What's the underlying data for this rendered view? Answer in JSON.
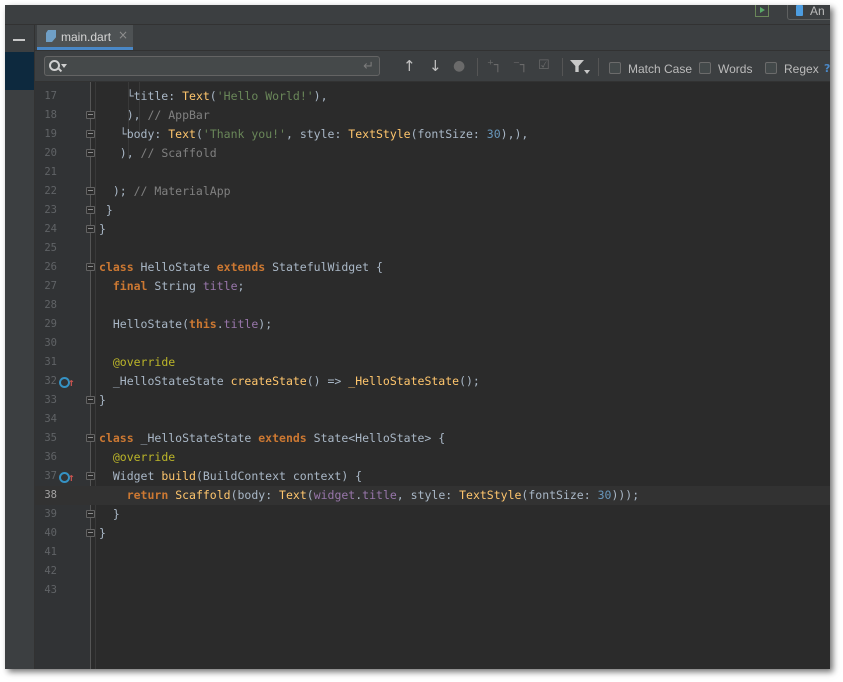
{
  "colors": {
    "background": "#2b2b2b",
    "keyword": "#cc7832",
    "function": "#ffc66d",
    "string": "#6a8759",
    "number": "#6897bb",
    "comment": "#808080",
    "field": "#9876aa",
    "annotation": "#bbb529",
    "accent": "#4a88c7"
  },
  "toolbar": {
    "device_label": "An"
  },
  "tabs": [
    {
      "label": "main.dart",
      "close": "×",
      "icon": "dart-file-icon"
    }
  ],
  "search": {
    "value": "",
    "placeholder": "",
    "options": {
      "match_case": "Match Case",
      "words": "Words",
      "regex": "Regex",
      "help": "?"
    },
    "icons": [
      "search-icon",
      "enter-icon",
      "arrow-up-icon",
      "arrow-down-icon",
      "find-all-icon",
      "add-occurrence-icon",
      "remove-occurrence-icon",
      "select-all-occurrences-icon",
      "filter-icon"
    ]
  },
  "editor": {
    "current_line": 38,
    "lines": [
      {
        "num": "17",
        "tokens": [
          [
            "",
            "    └title: "
          ],
          [
            "fn",
            "Text"
          ],
          [
            "",
            "("
          ],
          [
            "str",
            "'Hello World!'"
          ],
          [
            "",
            "),"
          ]
        ]
      },
      {
        "num": "18",
        "tokens": [
          [
            "",
            "    ), "
          ],
          [
            "cm",
            "// AppBar"
          ]
        ]
      },
      {
        "num": "19",
        "tokens": [
          [
            "",
            "   └body: "
          ],
          [
            "fn",
            "Text"
          ],
          [
            "",
            "("
          ],
          [
            "str",
            "'Thank you!'"
          ],
          [
            "",
            ", style: "
          ],
          [
            "fn",
            "TextStyle"
          ],
          [
            "",
            "(fontSize: "
          ],
          [
            "num",
            "30"
          ],
          [
            "",
            "),),"
          ]
        ]
      },
      {
        "num": "20",
        "tokens": [
          [
            "",
            "   ), "
          ],
          [
            "cm",
            "// Scaffold"
          ]
        ]
      },
      {
        "num": "21",
        "tokens": []
      },
      {
        "num": "22",
        "tokens": [
          [
            "",
            "  ); "
          ],
          [
            "cm",
            "// MaterialApp"
          ]
        ]
      },
      {
        "num": "23",
        "tokens": [
          [
            "",
            " }"
          ]
        ]
      },
      {
        "num": "24",
        "tokens": [
          [
            "",
            "}"
          ]
        ]
      },
      {
        "num": "25",
        "tokens": []
      },
      {
        "num": "26",
        "tokens": [
          [
            "kw",
            "class"
          ],
          [
            "",
            " HelloState "
          ],
          [
            "kw",
            "extends"
          ],
          [
            "",
            " StatefulWidget {"
          ]
        ]
      },
      {
        "num": "27",
        "tokens": [
          [
            "",
            "  "
          ],
          [
            "kw",
            "final"
          ],
          [
            "",
            " String "
          ],
          [
            "fld",
            "title"
          ],
          [
            "",
            ";"
          ]
        ]
      },
      {
        "num": "28",
        "tokens": []
      },
      {
        "num": "29",
        "tokens": [
          [
            "",
            "  HelloState("
          ],
          [
            "kw",
            "this"
          ],
          [
            "",
            "."
          ],
          [
            "fld",
            "title"
          ],
          [
            "",
            ");"
          ]
        ]
      },
      {
        "num": "30",
        "tokens": []
      },
      {
        "num": "31",
        "tokens": [
          [
            "",
            "  "
          ],
          [
            "ann",
            "@override"
          ]
        ]
      },
      {
        "num": "32",
        "tokens": [
          [
            "",
            "  _HelloStateState "
          ],
          [
            "fn",
            "createState"
          ],
          [
            "",
            "() => "
          ],
          [
            "fn",
            "_HelloStateState"
          ],
          [
            "",
            "();"
          ]
        ]
      },
      {
        "num": "33",
        "tokens": [
          [
            "",
            "}"
          ]
        ]
      },
      {
        "num": "34",
        "tokens": []
      },
      {
        "num": "35",
        "tokens": [
          [
            "kw",
            "class"
          ],
          [
            "",
            " _HelloStateState "
          ],
          [
            "kw",
            "extends"
          ],
          [
            "",
            " State<HelloState> {"
          ]
        ]
      },
      {
        "num": "36",
        "tokens": [
          [
            "",
            "  "
          ],
          [
            "ann",
            "@override"
          ]
        ]
      },
      {
        "num": "37",
        "tokens": [
          [
            "",
            "  Widget "
          ],
          [
            "fn",
            "build"
          ],
          [
            "",
            "(BuildContext context) {"
          ]
        ]
      },
      {
        "num": "38",
        "tokens": [
          [
            "",
            "    "
          ],
          [
            "kw",
            "return"
          ],
          [
            "",
            " "
          ],
          [
            "fn",
            "Scaffold"
          ],
          [
            "",
            "(body: "
          ],
          [
            "fn",
            "Text"
          ],
          [
            "",
            "("
          ],
          [
            "fld",
            "widget"
          ],
          [
            "",
            "."
          ],
          [
            "fld",
            "title"
          ],
          [
            "",
            ", style: "
          ],
          [
            "fn",
            "TextStyle"
          ],
          [
            "",
            "(fontSize: "
          ],
          [
            "num",
            "30"
          ],
          [
            "",
            ")));"
          ]
        ]
      },
      {
        "num": "39",
        "tokens": [
          [
            "",
            "  }"
          ]
        ]
      },
      {
        "num": "40",
        "tokens": [
          [
            "",
            "}"
          ]
        ]
      },
      {
        "num": "41",
        "tokens": []
      },
      {
        "num": "42",
        "tokens": []
      },
      {
        "num": "43",
        "tokens": []
      }
    ],
    "folds": [
      "18",
      "19",
      "20",
      "22",
      "23",
      "24",
      "26",
      "33",
      "35",
      "37",
      "39",
      "40"
    ],
    "override_markers": [
      "32",
      "37"
    ]
  }
}
